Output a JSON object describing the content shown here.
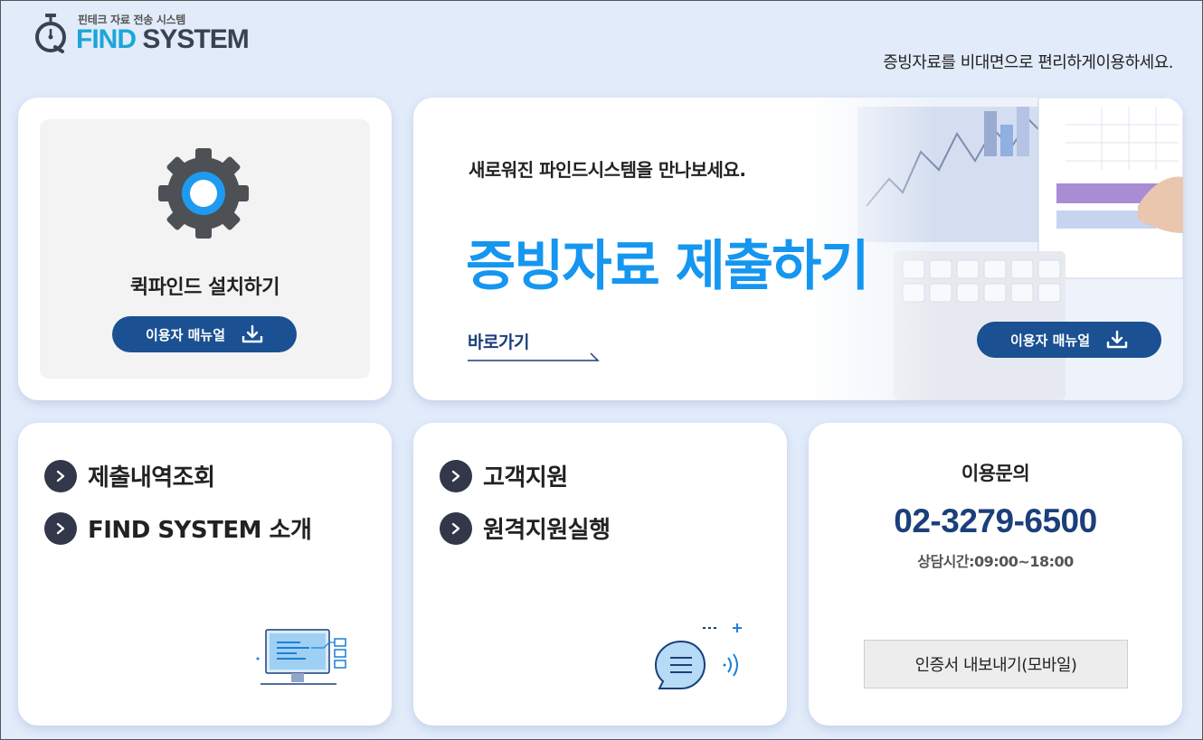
{
  "header": {
    "tagline": "핀테크 자료 전송 시스템",
    "brand_part1": "FIND",
    "brand_part2": "SYSTEM",
    "slogan": "증빙자료를 비대면으로 편리하게이용하세요."
  },
  "install_card": {
    "title": "퀵파인드 설치하기",
    "manual_button": "이용자 매뉴얼",
    "icon": "gear-icon"
  },
  "hero_card": {
    "subtitle": "새로워진 파인드시스템을 만나보세요.",
    "title": "증빙자료 제출하기",
    "link": "바로가기",
    "manual_button": "이용자 매뉴얼"
  },
  "menu_card_1": {
    "items": [
      {
        "label": "제출내역조회"
      },
      {
        "label": "FIND SYSTEM 소개"
      }
    ],
    "illustration": "computer-icon"
  },
  "menu_card_2": {
    "items": [
      {
        "label": "고객지원"
      },
      {
        "label": "원격지원실행"
      }
    ],
    "illustration": "chat-bubble-icon"
  },
  "contact_card": {
    "title": "이용문의",
    "phone": "02-3279-6500",
    "hours": "상담시간:09:00~18:00",
    "cert_button": "인증서 내보내기(모바일)"
  },
  "colors": {
    "background": "#e1ebfa",
    "primary_button": "#1b5092",
    "hero_title": "#1596f0",
    "phone": "#1b3f7a",
    "brand_blue": "#1ca6d8",
    "brand_dark": "#39424e"
  }
}
